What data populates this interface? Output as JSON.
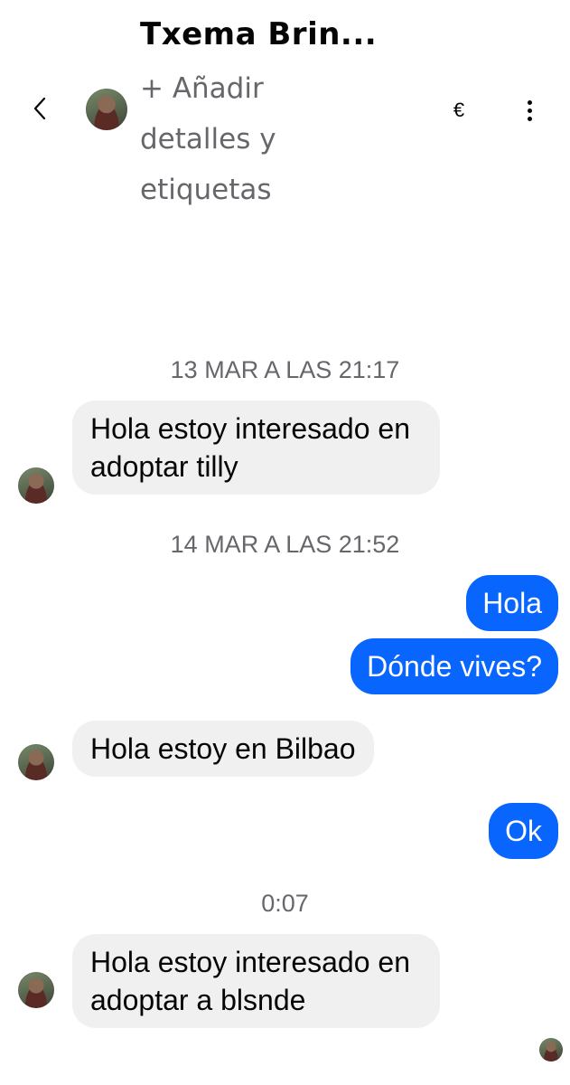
{
  "header": {
    "back_icon": "chevron-left-icon",
    "contact_name": "Txema Brin...",
    "add_details": "+ Añadir detalles y etiquetas",
    "currency_icon": "€",
    "more_icon": "vertical-ellipsis-icon"
  },
  "conversation": {
    "timestamps": [
      "13 MAR A LAS 21:17",
      "14 MAR A LAS 21:52",
      "0:07"
    ],
    "messages": [
      {
        "from": "contact",
        "text": "Hola estoy interesado en adoptar tilly"
      },
      {
        "from": "me",
        "text": "Hola"
      },
      {
        "from": "me",
        "text": "Dónde vives?"
      },
      {
        "from": "contact",
        "text": "Hola estoy en Bilbao"
      },
      {
        "from": "me",
        "text": "Ok"
      },
      {
        "from": "contact",
        "text": "Hola estoy interesado en adoptar a blsnde"
      }
    ]
  },
  "colors": {
    "outgoing_bubble": "#0866ff",
    "incoming_bubble": "#f0f0f0",
    "secondary_text": "#65676b"
  }
}
